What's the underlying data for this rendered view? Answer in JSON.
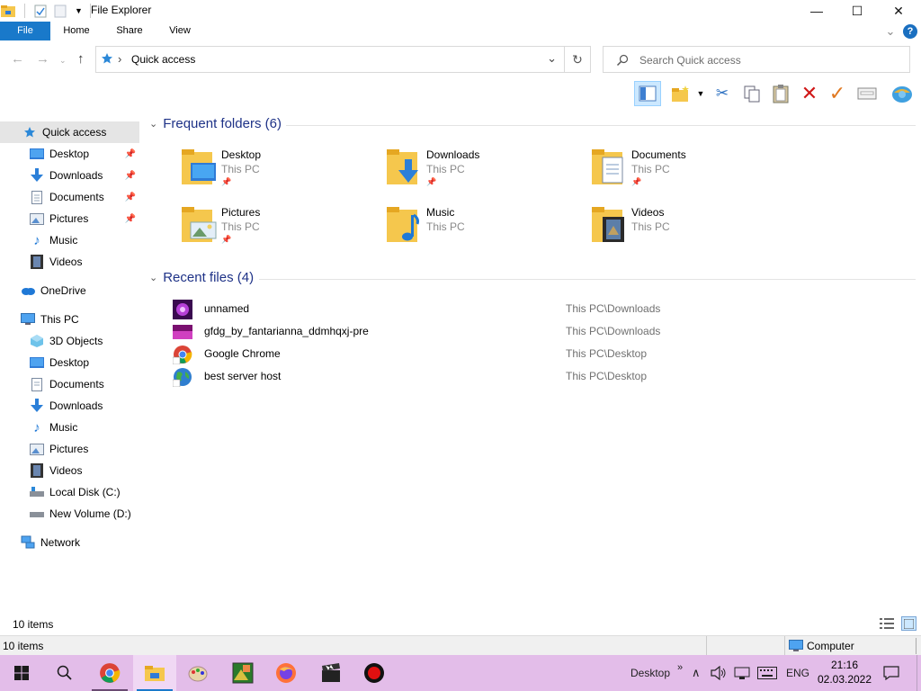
{
  "window": {
    "title": "File Explorer",
    "controls": {
      "minimize": "—",
      "maximize": "☐",
      "close": "✕"
    }
  },
  "ribbon": {
    "tabs": [
      {
        "label": "File"
      },
      {
        "label": "Home"
      },
      {
        "label": "Share"
      },
      {
        "label": "View"
      }
    ],
    "help": "?",
    "expand": "⌄"
  },
  "address": {
    "path_label": "Quick access",
    "separator": "›",
    "dropdown": "⌄",
    "refresh": "↻",
    "back": "←",
    "forward": "→",
    "recent": "⌄",
    "up": "↑"
  },
  "search": {
    "placeholder": "Search Quick access",
    "icon": "search-icon"
  },
  "nav": {
    "quick_access": "Quick access",
    "quick_items": [
      {
        "label": "Desktop",
        "pinned": true
      },
      {
        "label": "Downloads",
        "pinned": true
      },
      {
        "label": "Documents",
        "pinned": true
      },
      {
        "label": "Pictures",
        "pinned": true
      },
      {
        "label": "Music",
        "pinned": false
      },
      {
        "label": "Videos",
        "pinned": false
      }
    ],
    "onedrive": "OneDrive",
    "this_pc": "This PC",
    "pc_items": [
      {
        "label": "3D Objects"
      },
      {
        "label": "Desktop"
      },
      {
        "label": "Documents"
      },
      {
        "label": "Downloads"
      },
      {
        "label": "Music"
      },
      {
        "label": "Pictures"
      },
      {
        "label": "Videos"
      },
      {
        "label": "Local Disk (C:)"
      },
      {
        "label": "New Volume (D:)"
      }
    ],
    "network": "Network"
  },
  "frequent": {
    "header": "Frequent folders (6)",
    "folders": [
      {
        "name": "Desktop",
        "location": "This PC",
        "pinned": true
      },
      {
        "name": "Downloads",
        "location": "This PC",
        "pinned": true
      },
      {
        "name": "Documents",
        "location": "This PC",
        "pinned": true
      },
      {
        "name": "Pictures",
        "location": "This PC",
        "pinned": true
      },
      {
        "name": "Music",
        "location": "This PC",
        "pinned": false
      },
      {
        "name": "Videos",
        "location": "This PC",
        "pinned": false
      }
    ]
  },
  "recent": {
    "header": "Recent files (4)",
    "files": [
      {
        "name": "unnamed",
        "path": "This PC\\Downloads"
      },
      {
        "name": "gfdg_by_fantarianna_ddmhqxj-pre",
        "path": "This PC\\Downloads"
      },
      {
        "name": "Google Chrome",
        "path": "This PC\\Desktop"
      },
      {
        "name": "best server host",
        "path": "This PC\\Desktop"
      }
    ]
  },
  "status": {
    "items": "10 items",
    "items2": "10 items",
    "computer": "Computer"
  },
  "taskbar": {
    "desktop_label": "Desktop",
    "chevron": "»",
    "language": "ENG",
    "time": "21:16",
    "date": "02.03.2022"
  },
  "colors": {
    "file_tab": "#1979ca",
    "header_text": "#1e3287",
    "selected_nav": "#cce8ff",
    "taskbar": "#e3bde9",
    "folder": "#f5c74d"
  }
}
